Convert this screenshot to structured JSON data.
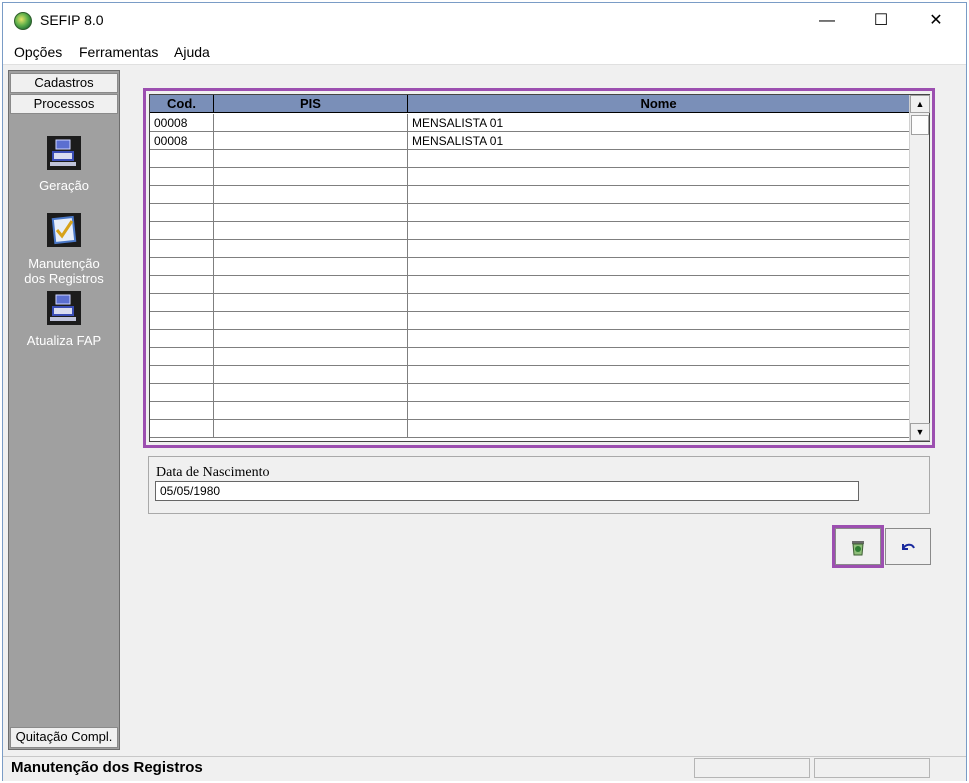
{
  "window": {
    "title": "SEFIP 8.0",
    "controls": {
      "minimize": "—",
      "maximize": "☐",
      "close": "✕"
    }
  },
  "menubar": [
    "Opções",
    "Ferramentas",
    "Ajuda"
  ],
  "sidebar": {
    "tabs": [
      "Cadastros",
      "Processos"
    ],
    "items": [
      {
        "label": "Geração",
        "icon": "computer-icon"
      },
      {
        "label_line1": "Manutenção",
        "label_line2": "dos Registros",
        "icon": "checklist-icon"
      },
      {
        "label": "Atualiza FAP",
        "icon": "computer-icon"
      }
    ],
    "bottom_tab": "Quitação Compl."
  },
  "grid": {
    "columns": [
      "Cod.",
      "PIS",
      "Nome"
    ],
    "rows": [
      {
        "cod": "00008",
        "pis": "",
        "nome": "MENSALISTA 01"
      },
      {
        "cod": "00008",
        "pis": "",
        "nome": "MENSALISTA 01"
      }
    ]
  },
  "birth_date": {
    "label": "Data de Nascimento",
    "value": "05/05/1980"
  },
  "actions": {
    "delete_icon": "trash-icon",
    "undo_icon": "undo-icon"
  },
  "statusbar": {
    "text": "Manutenção dos Registros"
  },
  "colors": {
    "highlight": "#9c4fb0",
    "grid_header": "#7a8fb8",
    "sidebar_bg": "#a0a0a0"
  }
}
